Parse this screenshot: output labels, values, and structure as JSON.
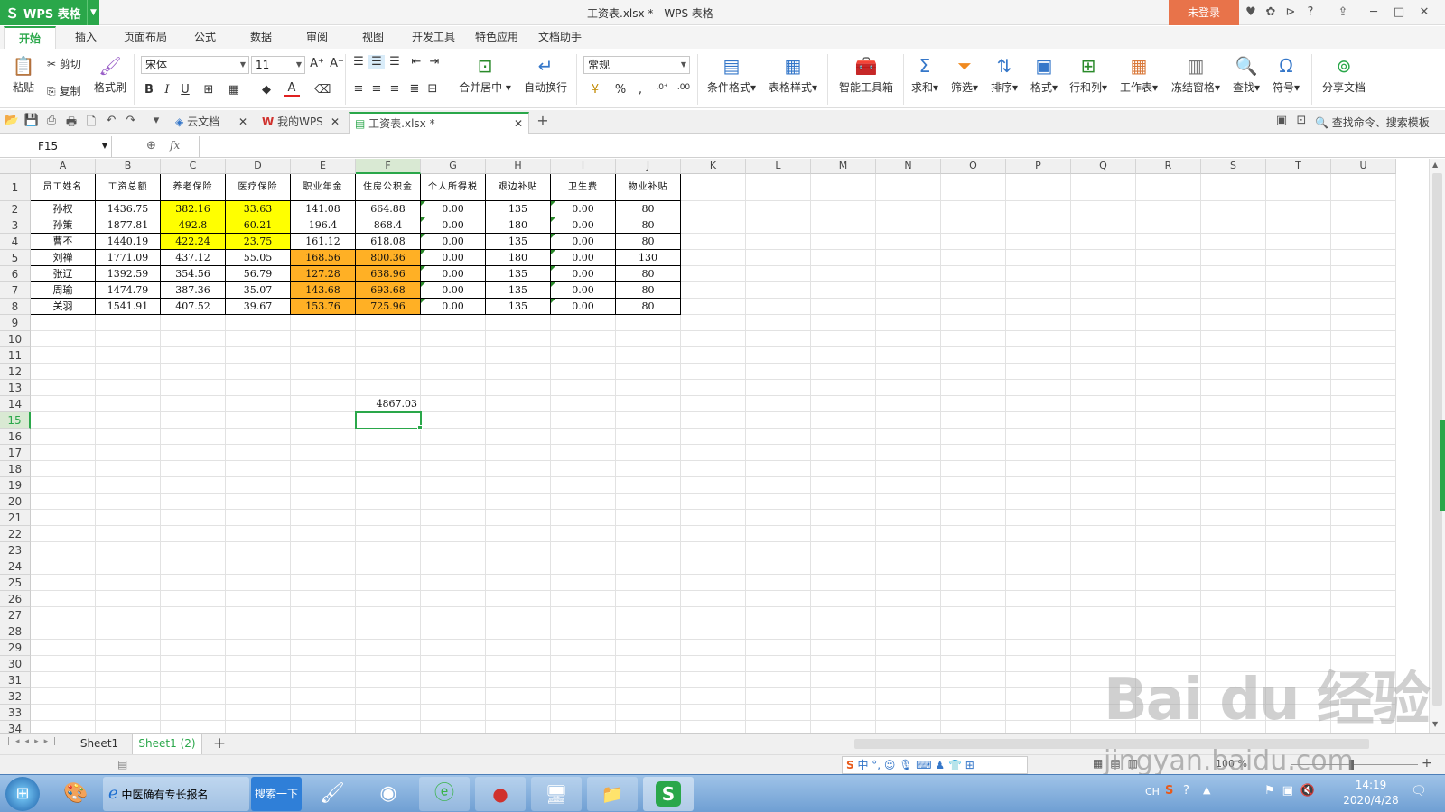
{
  "app": {
    "name": "WPS 表格",
    "window_title": "工资表.xlsx * - WPS 表格",
    "login_button": "未登录"
  },
  "menu": [
    "开始",
    "插入",
    "页面布局",
    "公式",
    "数据",
    "审阅",
    "视图",
    "开发工具",
    "特色应用",
    "文档助手"
  ],
  "ribbon": {
    "paste": "粘贴",
    "cut": "剪切",
    "copy": "复制",
    "format_painter": "格式刷",
    "font_name": "宋体",
    "font_size": "11",
    "merge_center": "合并居中",
    "wrap_text": "自动换行",
    "number_format": "常规",
    "conditional_format": "条件格式",
    "table_style": "表格样式",
    "smart_toolbox": "智能工具箱",
    "sum": "求和",
    "filter": "筛选",
    "sort": "排序",
    "format": "格式",
    "rows_cols": "行和列",
    "worksheet": "工作表",
    "freeze": "冻结窗格",
    "find": "查找",
    "symbol": "符号",
    "share": "分享文档"
  },
  "tabs": {
    "cloud": "云文档",
    "mywps": "我的WPS",
    "file": "工资表.xlsx *",
    "search": "查找命令、搜索模板"
  },
  "formula_bar": {
    "cell_ref": "F15",
    "fx": "fx",
    "content": ""
  },
  "grid": {
    "columns": [
      "A",
      "B",
      "C",
      "D",
      "E",
      "F",
      "G",
      "H",
      "I",
      "J",
      "K",
      "L",
      "M",
      "N",
      "O",
      "P",
      "Q",
      "R",
      "S",
      "T",
      "U"
    ],
    "rows": [
      "1",
      "2",
      "3",
      "4",
      "5",
      "6",
      "7",
      "8",
      "9",
      "10",
      "11",
      "12",
      "13",
      "14",
      "15",
      "16",
      "17",
      "18",
      "19",
      "20",
      "21",
      "22",
      "23",
      "24",
      "25",
      "26",
      "27",
      "28",
      "29",
      "30",
      "31",
      "32",
      "33",
      "34"
    ],
    "headers": [
      "员工姓名",
      "工资总额",
      "养老保险",
      "医疗保险",
      "职业年金",
      "住房公积金",
      "个人所得税",
      "艰边补贴",
      "卫生费",
      "物业补贴"
    ],
    "data": [
      [
        "孙权",
        "1436.75",
        "382.16",
        "33.63",
        "141.08",
        "664.88",
        "0.00",
        "135",
        "0.00",
        "80"
      ],
      [
        "孙策",
        "1877.81",
        "492.8",
        "60.21",
        "196.4",
        "868.4",
        "0.00",
        "180",
        "0.00",
        "80"
      ],
      [
        "曹丕",
        "1440.19",
        "422.24",
        "23.75",
        "161.12",
        "618.08",
        "0.00",
        "135",
        "0.00",
        "80"
      ],
      [
        "刘禅",
        "1771.09",
        "437.12",
        "55.05",
        "168.56",
        "800.36",
        "0.00",
        "180",
        "0.00",
        "130"
      ],
      [
        "张辽",
        "1392.59",
        "354.56",
        "56.79",
        "127.28",
        "638.96",
        "0.00",
        "135",
        "0.00",
        "80"
      ],
      [
        "周瑜",
        "1474.79",
        "387.36",
        "35.07",
        "143.68",
        "693.68",
        "0.00",
        "135",
        "0.00",
        "80"
      ],
      [
        "关羽",
        "1541.91",
        "407.52",
        "39.67",
        "153.76",
        "725.96",
        "0.00",
        "135",
        "0.00",
        "80"
      ]
    ],
    "f14": "4867.03",
    "active_cell": "F15"
  },
  "sheets": [
    "Sheet1",
    "Sheet1 (2)"
  ],
  "status": {
    "zoom": "100 %"
  },
  "taskbar": {
    "ie_text": "中医确有专长报名",
    "search_btn": "搜索一下",
    "tray_lang": "CH",
    "time": "14:19",
    "date": "2020/4/28"
  },
  "watermark": {
    "brand": "Bai du 经验",
    "url": "jingyan.baidu.com"
  },
  "colors": {
    "accent": "#2aa74a",
    "yellow": "#ffff00",
    "orange": "#ffb025",
    "login": "#e8734a"
  }
}
